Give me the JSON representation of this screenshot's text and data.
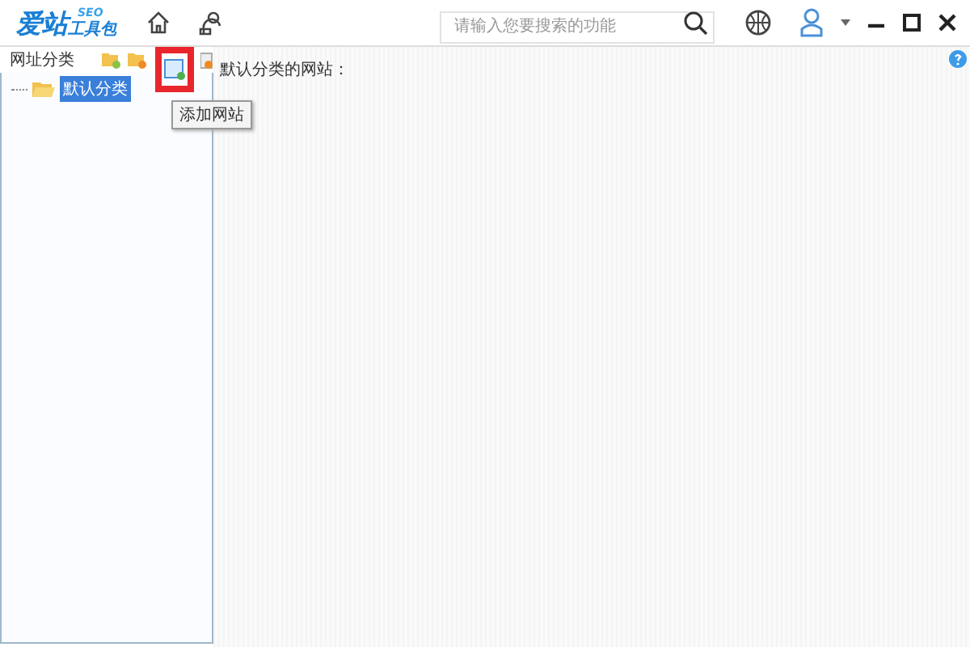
{
  "logo": {
    "main": "爱站",
    "sub": "工具包",
    "tag": "SEO"
  },
  "search": {
    "placeholder": "请输入您要搜索的功能"
  },
  "sidebar": {
    "title": "网址分类",
    "tree": [
      {
        "label": "默认分类",
        "selected": true
      }
    ],
    "tooltip": "添加网站"
  },
  "content": {
    "label": "默认分类的网站："
  }
}
